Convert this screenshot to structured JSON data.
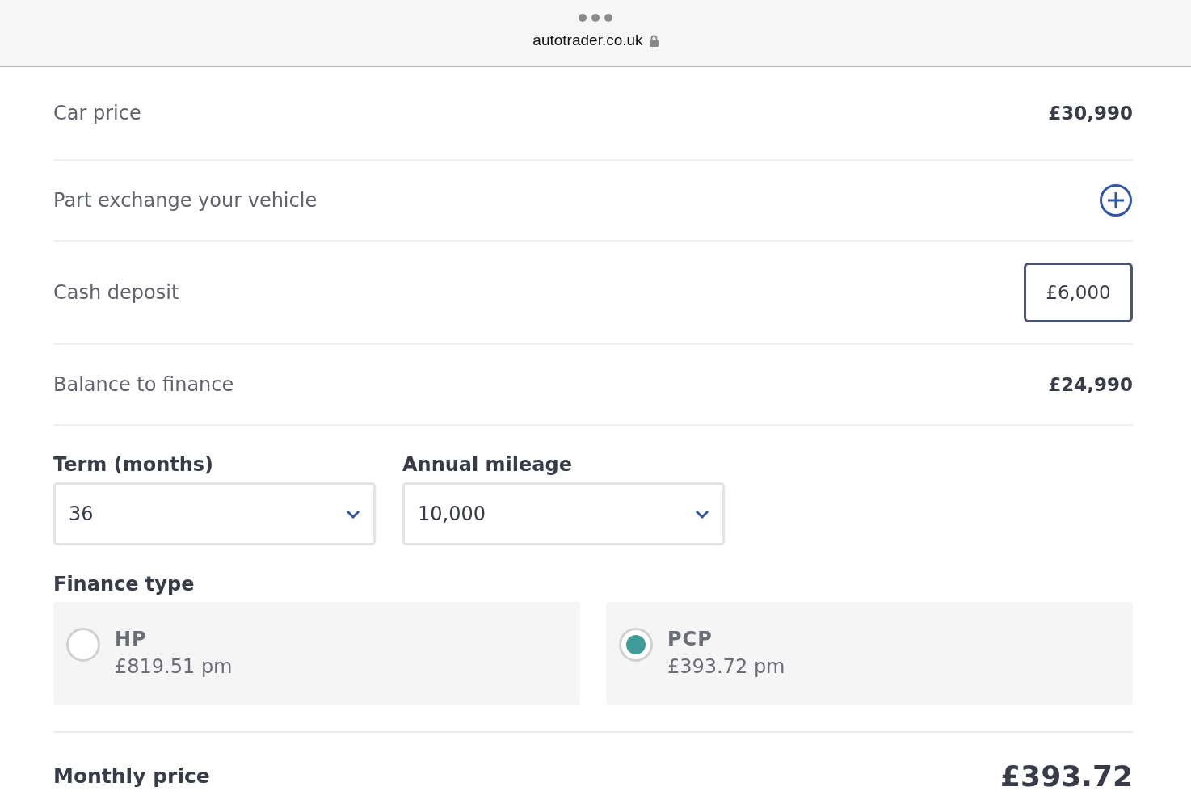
{
  "browser": {
    "url": "autotrader.co.uk"
  },
  "rows": [
    {
      "kind": "value",
      "label": "Car price",
      "value": "£30,990"
    },
    {
      "kind": "add",
      "label": "Part exchange your vehicle"
    },
    {
      "kind": "input",
      "label": "Cash deposit",
      "value": "£6,000"
    },
    {
      "kind": "value",
      "label": "Balance to finance",
      "value": "£24,990"
    }
  ],
  "selects": [
    {
      "label": "Term (months)",
      "value": "36"
    },
    {
      "label": "Annual mileage",
      "value": "10,000"
    }
  ],
  "finance_type": {
    "label": "Finance type",
    "options": [
      {
        "name": "HP",
        "price": "£819.51 pm",
        "selected": false
      },
      {
        "name": "PCP",
        "price": "£393.72 pm",
        "selected": true
      }
    ]
  },
  "monthly_price": {
    "label": "Monthly price",
    "value": "£393.72"
  }
}
